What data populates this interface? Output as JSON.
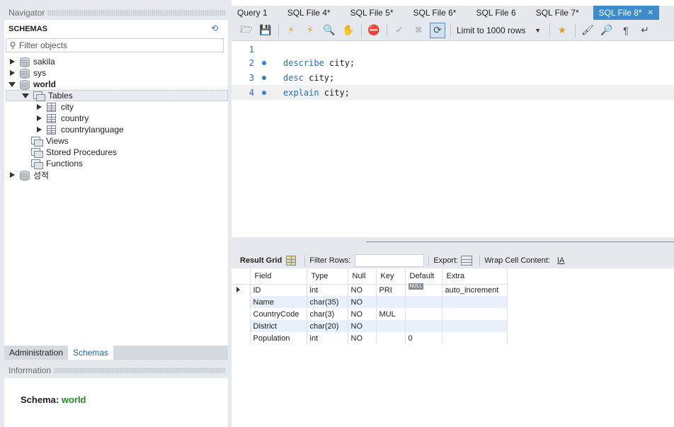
{
  "navigator": {
    "title": "Navigator",
    "schemas_title": "SCHEMAS",
    "filter_placeholder": "Filter objects",
    "schemas": [
      {
        "name": "sakila",
        "expanded": false,
        "bold": false
      },
      {
        "name": "sys",
        "expanded": false,
        "bold": false
      },
      {
        "name": "world",
        "expanded": true,
        "bold": true
      },
      {
        "name": "성적",
        "expanded": false,
        "bold": false
      }
    ],
    "world_children": {
      "tables_label": "Tables",
      "tables": [
        "city",
        "country",
        "countrylanguage"
      ],
      "views_label": "Views",
      "procedures_label": "Stored Procedures",
      "functions_label": "Functions"
    }
  },
  "left_tabs": [
    {
      "label": "Administration",
      "active": false
    },
    {
      "label": "Schemas",
      "active": true
    }
  ],
  "information": {
    "title": "Information",
    "schema_label": "Schema:",
    "schema_value": "world"
  },
  "editor_tabs": [
    {
      "label": "Query 1",
      "active": false
    },
    {
      "label": "SQL File 4*",
      "active": false
    },
    {
      "label": "SQL File 5*",
      "active": false
    },
    {
      "label": "SQL File 6*",
      "active": false
    },
    {
      "label": "SQL File 6",
      "active": false
    },
    {
      "label": "SQL File 7*",
      "active": false
    },
    {
      "label": "SQL File 8*",
      "active": true
    }
  ],
  "toolbar": {
    "limit_label": "Limit to 1000 rows"
  },
  "editor": {
    "lines": [
      {
        "num": "1",
        "keyword": "",
        "rest": "",
        "marker": false
      },
      {
        "num": "2",
        "keyword": "describe",
        "rest": " city;",
        "marker": true
      },
      {
        "num": "3",
        "keyword": "desc",
        "rest": " city;",
        "marker": true
      },
      {
        "num": "4",
        "keyword": "explain",
        "rest": " city;",
        "marker": true
      }
    ]
  },
  "result_bar": {
    "result_grid": "Result Grid",
    "filter_rows": "Filter Rows:",
    "export": "Export:",
    "wrap": "Wrap Cell Content:",
    "wrap_icon": "IA"
  },
  "grid": {
    "columns": [
      "Field",
      "Type",
      "Null",
      "Key",
      "Default",
      "Extra"
    ],
    "rows": [
      [
        "ID",
        "int",
        "NO",
        "PRI",
        "NULL",
        "auto_increment"
      ],
      [
        "Name",
        "char(35)",
        "NO",
        "",
        "",
        ""
      ],
      [
        "CountryCode",
        "char(3)",
        "NO",
        "MUL",
        "",
        ""
      ],
      [
        "District",
        "char(20)",
        "NO",
        "",
        "",
        ""
      ],
      [
        "Population",
        "int",
        "NO",
        "",
        "0",
        ""
      ]
    ]
  }
}
